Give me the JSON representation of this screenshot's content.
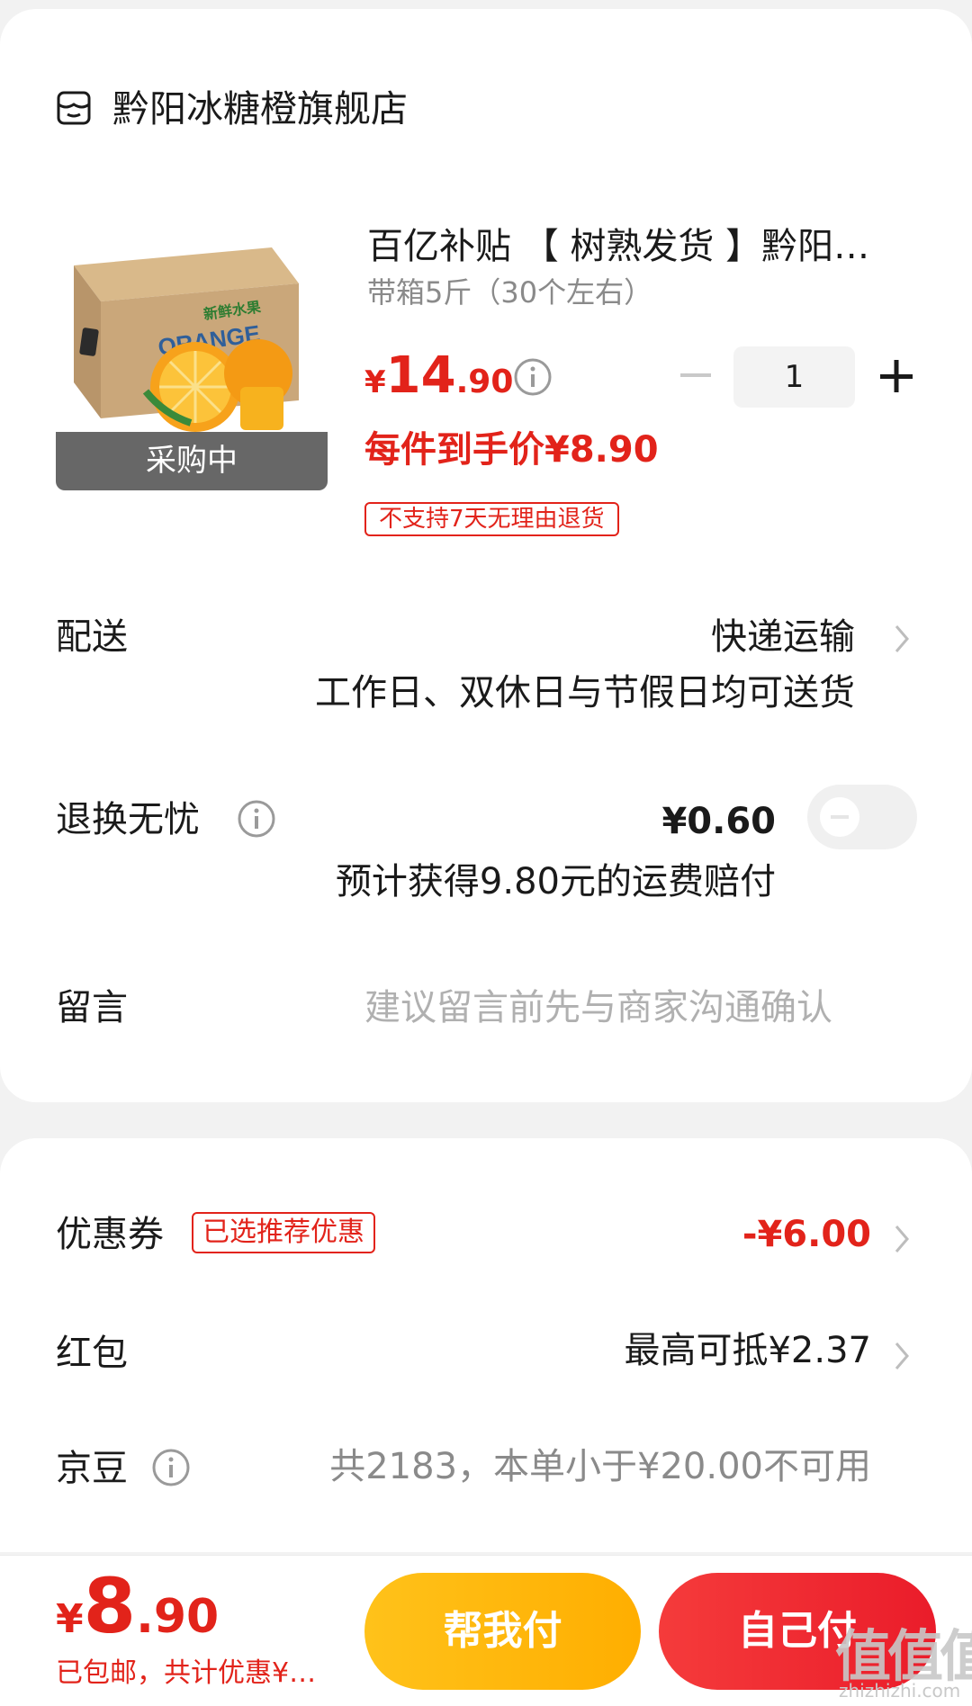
{
  "store": {
    "name": "黔阳冰糖橙旗舰店",
    "icon": "store-icon"
  },
  "product": {
    "title": "百亿补贴 【 树熟发货 】黔阳…",
    "spec": "带箱5斤（30个左右）",
    "image_badge": "采购中",
    "price_currency": "¥",
    "price_int": "14",
    "price_dec": ".90",
    "quantity": "1",
    "unit_price": "每件到手价¥8.90",
    "return_policy": "不支持7天无理由退货",
    "image_box_text": "新鲜水果",
    "image_box_brand": "ORANGE"
  },
  "delivery": {
    "label": "配送",
    "value": "快递运输",
    "sub": "工作日、双休日与节假日均可送货"
  },
  "return_worry": {
    "label": "退换无忧",
    "price": "¥0.60",
    "sub": "预计获得9.80元的运费赔付",
    "enabled": false
  },
  "message": {
    "label": "留言",
    "placeholder": "建议留言前先与商家沟通确认"
  },
  "coupon": {
    "label": "优惠券",
    "badge": "已选推荐优惠",
    "value": "-¥6.00"
  },
  "red_packet": {
    "label": "红包",
    "value": "最高可抵¥2.37"
  },
  "jingdou": {
    "label": "京豆",
    "value": "共2183，本单小于¥20.00不可用"
  },
  "footer": {
    "total_currency": "¥",
    "total_int": "8",
    "total_dec": ".90",
    "total_sub": "已包邮，共计优惠¥…",
    "help_pay": "帮我付",
    "self_pay": "自己付"
  },
  "watermark": {
    "text": "值值值",
    "url": "zhizhizhi.com"
  },
  "colors": {
    "accent_red": "#e2231a",
    "help_yellow": "#ffb800",
    "self_red": "#f03030"
  }
}
